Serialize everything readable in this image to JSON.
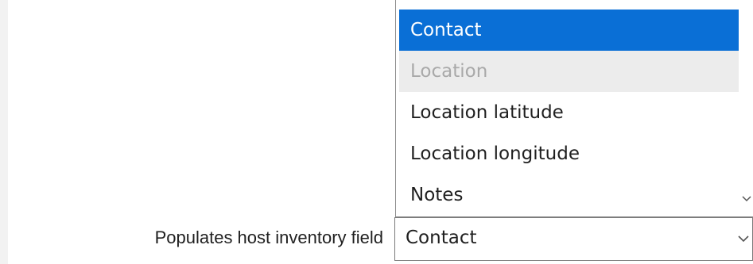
{
  "form": {
    "label": "Populates host inventory field",
    "selected_value": "Contact"
  },
  "dropdown": {
    "options": [
      {
        "label": "Contact",
        "state": "selected"
      },
      {
        "label": "Location",
        "state": "disabled"
      },
      {
        "label": "Location latitude",
        "state": "normal"
      },
      {
        "label": "Location longitude",
        "state": "normal"
      },
      {
        "label": "Notes",
        "state": "normal"
      }
    ]
  },
  "icons": {
    "select_arrow": "chevron-down-icon",
    "scroll_arrow": "scroll-down-icon"
  },
  "colors": {
    "selected_bg": "#0a6fd6",
    "disabled_bg": "#ececec",
    "disabled_text": "#a9a9a9"
  }
}
